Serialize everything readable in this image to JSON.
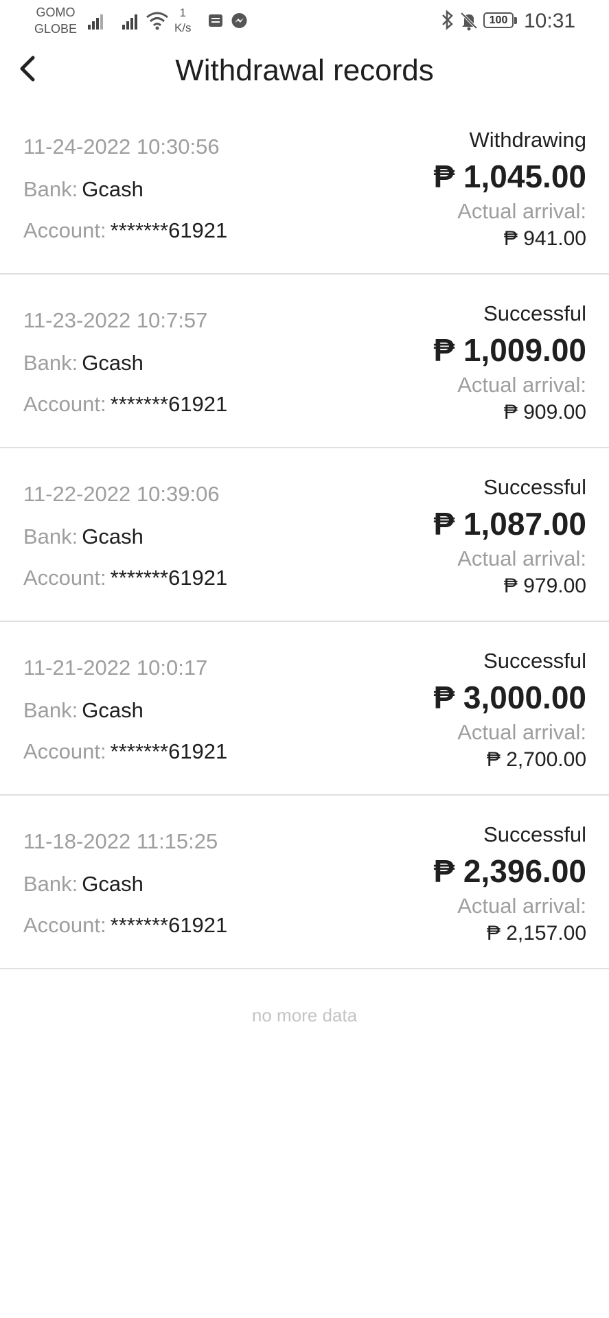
{
  "status_bar": {
    "carrier_1": "GOMO",
    "carrier_2": "GLOBE",
    "speed_value": "1",
    "speed_unit": "K/s",
    "battery": "100",
    "time": "10:31",
    "icons": [
      "signal-icon",
      "signal-icon",
      "wifi-icon",
      "sms-icon",
      "messenger-icon",
      "bluetooth-icon",
      "mute-icon",
      "battery-icon"
    ]
  },
  "header": {
    "title": "Withdrawal records",
    "back_icon": "chevron-left-icon"
  },
  "labels": {
    "bank": "Bank:",
    "account": "Account:",
    "actual_arrival": "Actual arrival:"
  },
  "records": [
    {
      "datetime": "11-24-2022 10:30:56",
      "bank": "Gcash",
      "account": "*******61921",
      "status": "Withdrawing",
      "amount": "₱ 1,045.00",
      "arrival": "₱ 941.00"
    },
    {
      "datetime": "11-23-2022 10:7:57",
      "bank": "Gcash",
      "account": "*******61921",
      "status": "Successful",
      "amount": "₱ 1,009.00",
      "arrival": "₱ 909.00"
    },
    {
      "datetime": "11-22-2022 10:39:06",
      "bank": "Gcash",
      "account": "*******61921",
      "status": "Successful",
      "amount": "₱ 1,087.00",
      "arrival": "₱ 979.00"
    },
    {
      "datetime": "11-21-2022 10:0:17",
      "bank": "Gcash",
      "account": "*******61921",
      "status": "Successful",
      "amount": "₱ 3,000.00",
      "arrival": "₱ 2,700.00"
    },
    {
      "datetime": "11-18-2022 11:15:25",
      "bank": "Gcash",
      "account": "*******61921",
      "status": "Successful",
      "amount": "₱ 2,396.00",
      "arrival": "₱ 2,157.00"
    }
  ],
  "footer": {
    "no_more": "no more data"
  },
  "colors": {
    "primary_text": "#1f1f1f",
    "secondary_text": "#9e9e9e",
    "divider": "#e0e0e0",
    "footer_text": "#c4c4c4"
  }
}
